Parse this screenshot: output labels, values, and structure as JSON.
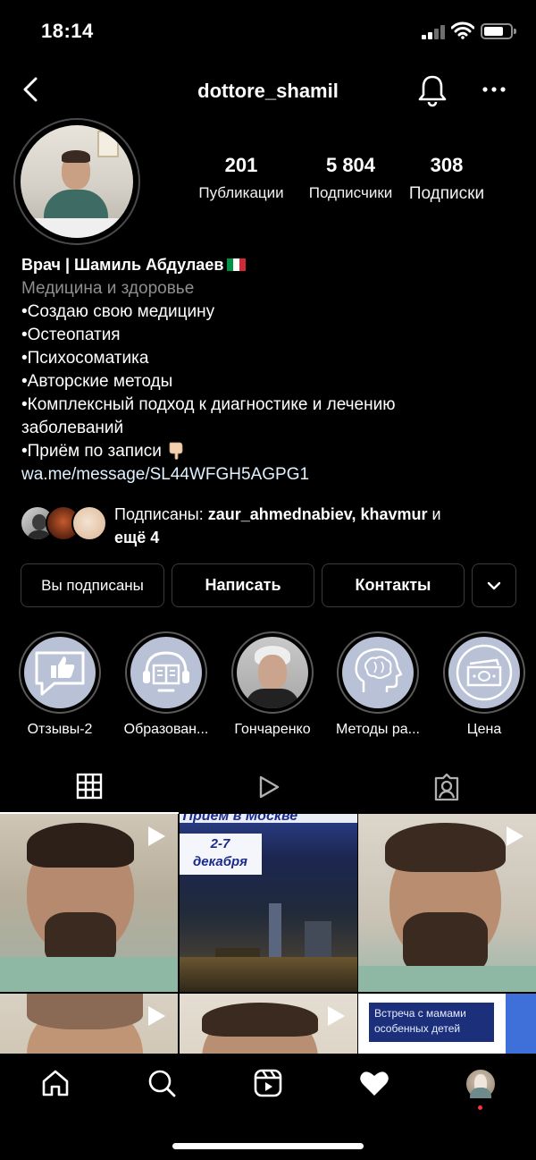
{
  "status_bar": {
    "time": "18:14"
  },
  "nav": {
    "username": "dottore_shamil"
  },
  "stats": [
    {
      "value": "201",
      "label": "Публикации"
    },
    {
      "value": "5 804",
      "label": "Подписчики"
    },
    {
      "value": "308",
      "label": "Подписки"
    }
  ],
  "bio": {
    "name": "Врач | Шамиль Абдулаев",
    "category": "Медицина и здоровье",
    "lines": [
      "•Создаю свою медицину",
      "•Остеопатия",
      "•Психосоматика",
      "•Авторские методы",
      "•Комплексный подход к диагностике и лечению",
      "заболеваний",
      "•Приём по записи"
    ],
    "link": "wa.me/message/SL44WFGH5AGPG1"
  },
  "followed_by": {
    "prefix": "Подписаны: ",
    "users": "zaur_ahmednabiev, khavmur",
    "and": " и",
    "more": "ещё 4"
  },
  "buttons": {
    "following": "Вы подписаны",
    "message": "Написать",
    "contacts": "Контакты"
  },
  "highlights": [
    {
      "label": "Отзывы-2",
      "icon": "thumbs-up-chat-icon"
    },
    {
      "label": "Образован...",
      "icon": "book-headset-icon"
    },
    {
      "label": "Гончаренко",
      "icon": "portrait-photo"
    },
    {
      "label": "Методы ра...",
      "icon": "brain-head-icon"
    },
    {
      "label": "Цена",
      "icon": "money-icon"
    }
  ],
  "tabs": [
    "grid-icon",
    "reels-icon",
    "tagged-icon"
  ],
  "posts": [
    {
      "type": "video",
      "caption": ""
    },
    {
      "type": "image",
      "caption": "Приём в Москве",
      "date": "2-7 декабря"
    },
    {
      "type": "video",
      "caption": ""
    },
    {
      "type": "video",
      "caption": ""
    },
    {
      "type": "video",
      "caption": ""
    },
    {
      "type": "image",
      "caption": "Встреча с мамами особенных детей"
    }
  ],
  "tab_bar": [
    "home-icon",
    "search-icon",
    "reels-icon",
    "activity-heart-icon",
    "profile-avatar"
  ],
  "colors": {
    "link": "#e0f1ff",
    "muted": "#8e8e8e",
    "highlight_bg": "#b9c1d6",
    "notification_dot": "#ff3040"
  }
}
